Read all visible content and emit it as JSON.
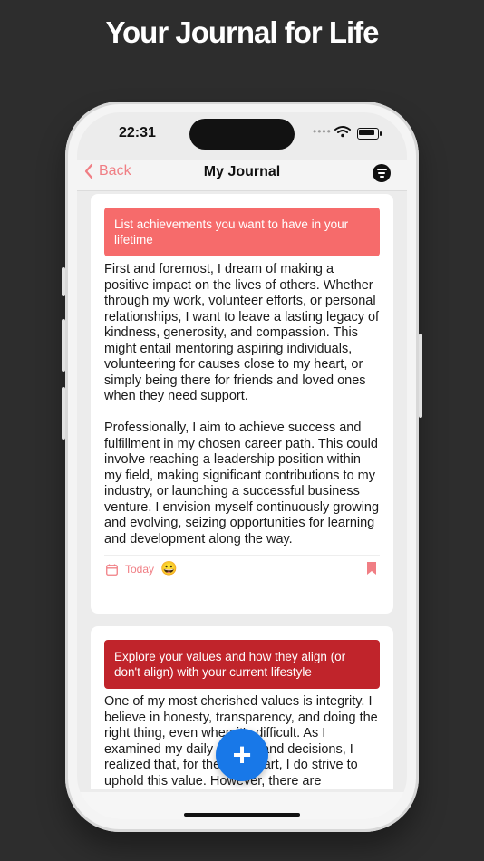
{
  "headline": "Your Journal for Life",
  "status": {
    "time": "22:31",
    "dots": "••••"
  },
  "nav": {
    "back_label": "Back",
    "title": "My Journal"
  },
  "entries": [
    {
      "prompt": "List achievements you want to have in your lifetime",
      "prompt_color": "#f66b6b",
      "paragraphs": [
        "First and foremost, I dream of making a positive impact on the lives of others. Whether through my work, volunteer efforts, or personal relationships, I want to leave a lasting legacy of kindness, generosity, and compassion. This might entail mentoring aspiring individuals, volunteering for causes close to my heart, or simply being there for friends and loved ones when they need support.",
        "Professionally, I aim to achieve success and fulfillment in my chosen career path. This could involve reaching a leadership position within my field, making significant contributions to my industry, or launching a successful business venture. I envision myself continuously growing and evolving, seizing opportunities for learning and development along the way."
      ],
      "date_label": "Today",
      "mood_emoji": "😀"
    },
    {
      "prompt": "Explore your values and how they align (or don't align) with your current lifestyle",
      "prompt_color": "#c0242b",
      "paragraphs": [
        "One of my most cherished values is integrity. I believe in honesty, transparency, and doing the right thing, even when it's difficult. As I examined my daily actions and decisions, I realized that, for the most part, I do strive to uphold this value. However, there are"
      ]
    }
  ],
  "fab_label": "+",
  "colors": {
    "accent": "#f07e84",
    "fab": "#1878e8"
  }
}
